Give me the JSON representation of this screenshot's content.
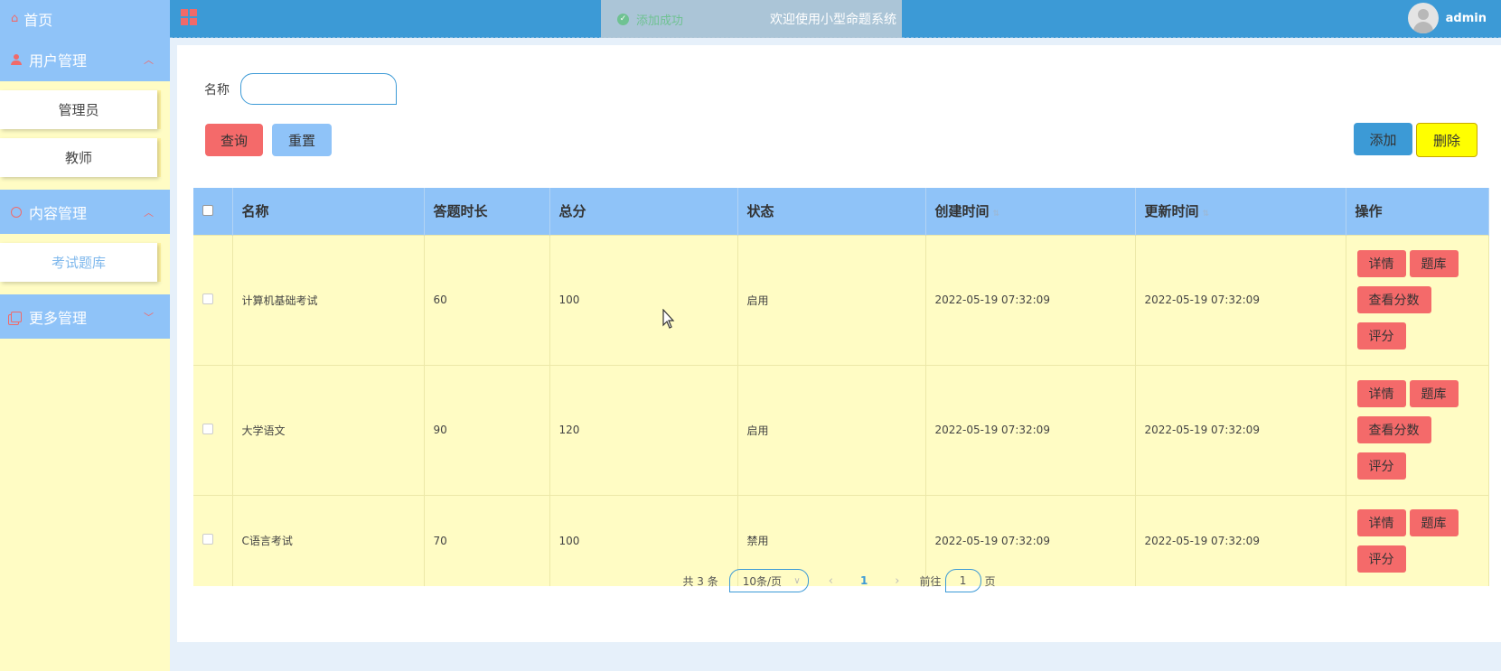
{
  "sidebar": {
    "home": "首页",
    "groups": [
      {
        "label": "用户管理",
        "items": [
          "管理员",
          "教师"
        ]
      },
      {
        "label": "内容管理",
        "items": [
          "考试题库"
        ]
      },
      {
        "label": "更多管理",
        "items": []
      }
    ]
  },
  "header": {
    "toast": "添加成功",
    "welcome": "欢迎使用小型命题系统",
    "user": "admin"
  },
  "search": {
    "label": "名称",
    "value": "",
    "placeholder": ""
  },
  "toolbar": {
    "query": "查询",
    "reset": "重置",
    "add": "添加",
    "delete": "删除"
  },
  "table": {
    "headers": [
      "名称",
      "答题时长",
      "总分",
      "状态",
      "创建时间",
      "更新时间",
      "操作"
    ],
    "rows": [
      {
        "name": "计算机基础考试",
        "duration": "60",
        "score": "100",
        "status": "启用",
        "created": "2022-05-19 07:32:09",
        "updated": "2022-05-19 07:32:09",
        "ops": [
          "详情",
          "题库",
          "查看分数",
          "评分"
        ]
      },
      {
        "name": "大学语文",
        "duration": "90",
        "score": "120",
        "status": "启用",
        "created": "2022-05-19 07:32:09",
        "updated": "2022-05-19 07:32:09",
        "ops": [
          "详情",
          "题库",
          "查看分数",
          "评分"
        ]
      },
      {
        "name": "C语言考试",
        "duration": "70",
        "score": "100",
        "status": "禁用",
        "created": "2022-05-19 07:32:09",
        "updated": "2022-05-19 07:32:09",
        "ops": [
          "详情",
          "题库",
          "评分"
        ]
      }
    ]
  },
  "pager": {
    "total": "共 3 条",
    "page_size": "10条/页",
    "current": "1",
    "goto_prefix": "前往",
    "goto_value": "1",
    "goto_suffix": "页"
  },
  "colors": {
    "sidebar_bg": "#fffcc4",
    "menu_blue": "#8fc3f8",
    "header_blue": "#3c9ad6",
    "danger_red": "#f46a6a",
    "delete_yellow": "#ffff00"
  }
}
